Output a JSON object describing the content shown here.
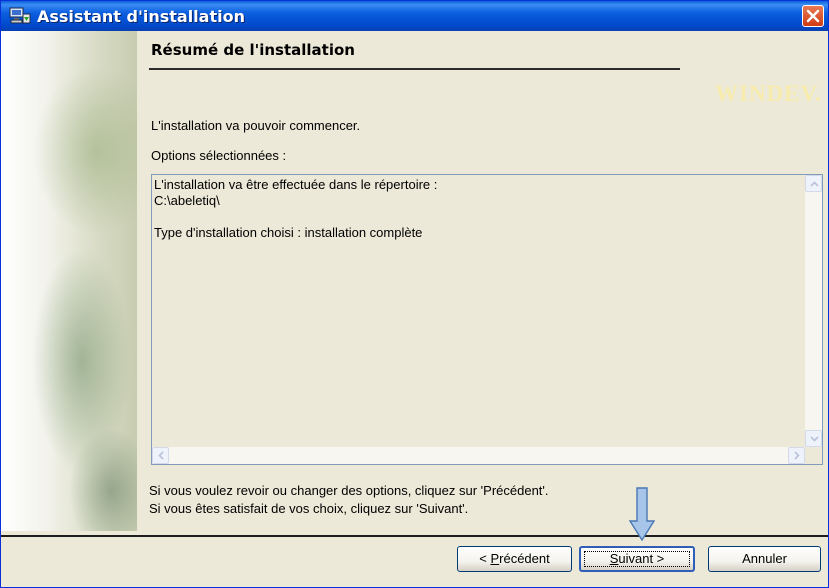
{
  "window": {
    "title": "Assistant d'installation",
    "colors": {
      "titlebar": "#0b5fe0",
      "close": "#d8522a",
      "face": "#ece9d8",
      "brand": "#f7ecae"
    }
  },
  "page": {
    "heading": "Résumé de l'installation",
    "brand": "WINDEV.",
    "intro": "L'installation va pouvoir commencer.",
    "options_label": "Options sélectionnées :",
    "summary_lines": [
      "L'installation va être effectuée dans le répertoire :",
      "C:\\abeletiq\\",
      "",
      "Type d'installation choisi : installation complète"
    ],
    "hint_line1": "Si vous voulez revoir ou changer des options, cliquez sur 'Précédent'.",
    "hint_line2": "Si vous êtes satisfait de vos choix, cliquez sur 'Suivant'."
  },
  "buttons": {
    "previous": {
      "before": "< ",
      "key": "P",
      "after": "récédent"
    },
    "next": {
      "key": "S",
      "after": "uivant >"
    },
    "cancel": "Annuler"
  },
  "icons": {
    "title": "computer-install-icon",
    "close": "close-icon",
    "pointer": "arrow-down-icon"
  }
}
